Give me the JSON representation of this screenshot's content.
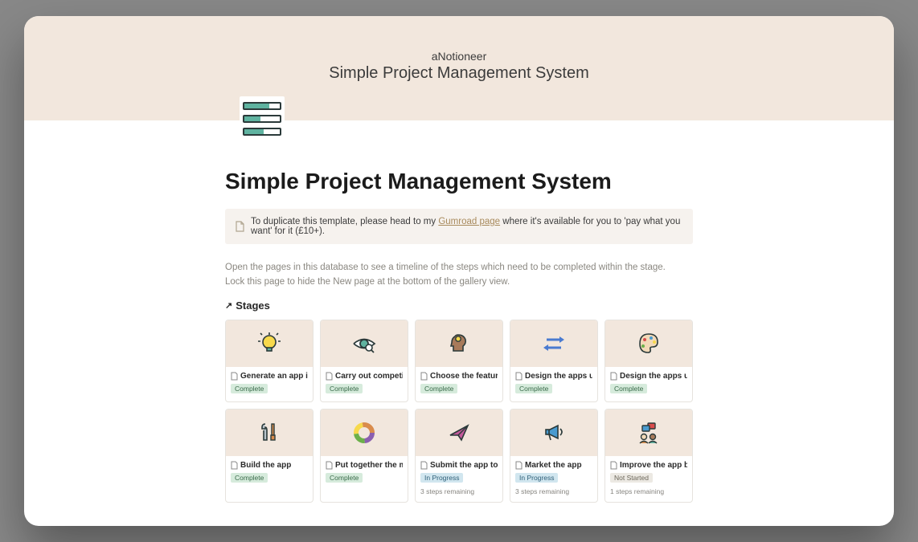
{
  "cover": {
    "brand": "aNotioneer",
    "subtitle": "Simple Project Management System"
  },
  "page": {
    "title": "Simple Project Management System"
  },
  "callout": {
    "prefix": "To duplicate this template, please head to my ",
    "link_text": "Gumroad page",
    "suffix": " where it's available for you to 'pay what you want' for it (£10+)."
  },
  "description": {
    "line1": "Open the pages in this database to see a timeline of the steps which need to be completed within the stage.",
    "line2": "Lock this page to hide the New page at the bottom of the gallery view."
  },
  "stages_header": "Stages",
  "status_labels": {
    "complete": "Complete",
    "progress": "In Progress",
    "notstarted": "Not Started"
  },
  "cards": [
    {
      "title": "Generate an app idea",
      "status": "complete",
      "remaining": ""
    },
    {
      "title": "Carry out competitiv...",
      "status": "complete",
      "remaining": ""
    },
    {
      "title": "Choose the features...",
      "status": "complete",
      "remaining": ""
    },
    {
      "title": "Design the apps use...",
      "status": "complete",
      "remaining": ""
    },
    {
      "title": "Design the apps use...",
      "status": "complete",
      "remaining": ""
    },
    {
      "title": "Build the app",
      "status": "complete",
      "remaining": ""
    },
    {
      "title": "Put together the ma...",
      "status": "complete",
      "remaining": ""
    },
    {
      "title": "Submit the app to th...",
      "status": "progress",
      "remaining": "3 steps remaining"
    },
    {
      "title": "Market the app",
      "status": "progress",
      "remaining": "3 steps remaining"
    },
    {
      "title": "Improve the app bas...",
      "status": "notstarted",
      "remaining": "1 steps remaining"
    }
  ]
}
